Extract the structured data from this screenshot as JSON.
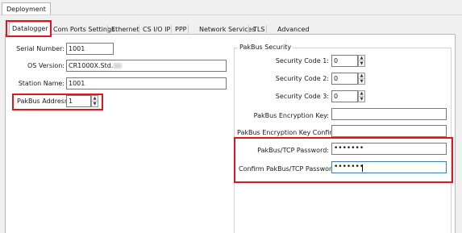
{
  "top_tab": {
    "label": "Deployment"
  },
  "tabs": [
    {
      "label": "Datalogger"
    },
    {
      "label": "Com Ports Settings"
    },
    {
      "label": "Ethernet"
    },
    {
      "label": "CS I/O IP"
    },
    {
      "label": "PPP"
    },
    {
      "label": "Network Services"
    },
    {
      "label": "TLS"
    },
    {
      "label": "Advanced"
    }
  ],
  "datalogger": {
    "serial_number": {
      "label": "Serial Number:",
      "value": "1001"
    },
    "os_version": {
      "label": "OS Version:",
      "value": "CR1000X.Std."
    },
    "station_name": {
      "label": "Station Name:",
      "value": "1001"
    },
    "pakbus_address": {
      "label": "PakBus Address:",
      "value": "1"
    }
  },
  "security": {
    "group_label": "PakBus Security",
    "code1": {
      "label": "Security Code 1:",
      "value": "0"
    },
    "code2": {
      "label": "Security Code 2:",
      "value": "0"
    },
    "code3": {
      "label": "Security Code 3:",
      "value": "0"
    },
    "enc_key": {
      "label": "PakBus Encryption Key:",
      "value": ""
    },
    "enc_key_confirm": {
      "label": "PakBus Encryption Key Confirm:",
      "value": ""
    },
    "tcp_password": {
      "label": "PakBus/TCP Password:",
      "value": "•••••••"
    },
    "tcp_password_confirm": {
      "label": "Confirm PakBus/TCP Password:",
      "value": "•••••••"
    }
  },
  "colors": {
    "highlight": "#e0161c",
    "focus_border": "#3c7fb1"
  },
  "icons": {
    "spinner_up": "triangle-up",
    "spinner_down": "triangle-down"
  }
}
